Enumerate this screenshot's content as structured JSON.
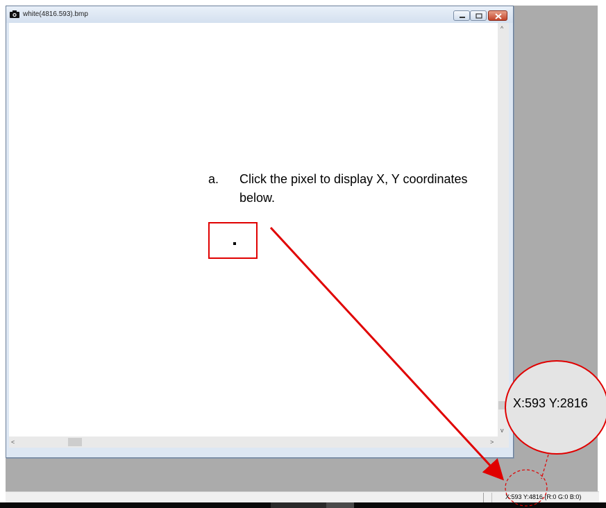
{
  "window": {
    "title": "white(4816.593).bmp",
    "icon": "camera-icon",
    "controls": [
      "minimize-icon",
      "maximize-icon",
      "close-icon"
    ]
  },
  "annotation": {
    "marker": "a.",
    "instruction": "Click the pixel to display X, Y coordinates below.",
    "zoom_label": "X:593 Y:2816",
    "color": "#e00000"
  },
  "statusbar": {
    "coords_text": "X:593 Y:4816 (R:0 G:0 B:0)"
  }
}
